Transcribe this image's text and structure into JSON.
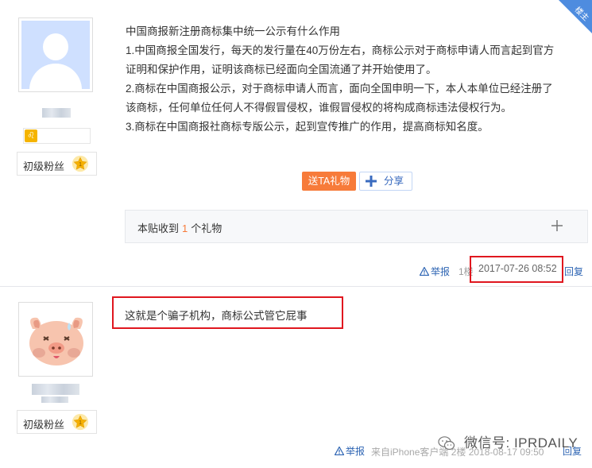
{
  "post1": {
    "badge": "楼主",
    "rank_label": "初级粉丝",
    "zodiac_symbol": "♌",
    "lines": [
      "中国商报新注册商标集中统一公示有什么作用",
      "1.中国商报全国发行，每天的发行量在40万份左右，商标公示对于商标申请人而言起到官方",
      "证明和保护作用，证明该商标已经面向全国流通了并开始使用了。",
      "2.商标在中国商报公示，对于商标申请人而言，面向全国申明一下，本人本单位已经注册了",
      "该商标，任何单位任何人不得假冒侵权，谁假冒侵权的将构成商标违法侵权行为。",
      "3.商标在中国商报社商标专版公示，起到宣传推广的作用，提高商标知名度。"
    ],
    "gift_button": "送TA礼物",
    "share_button": "分享",
    "gift_box": {
      "prefix": "本贴收到",
      "count": "1",
      "suffix": "个礼物"
    },
    "report": "举报",
    "floor": "1楼",
    "date": "2017-07-26 08:52",
    "reply": "回复"
  },
  "post2": {
    "rank_label": "初级粉丝",
    "text": "这就是个骗子机构，商标公式管它屁事",
    "report": "举报",
    "meta": "来自iPhone客户端  2楼  2018-08-17 09:50",
    "reply": "回复"
  },
  "watermark": {
    "text": "微信号: IPRDAILY"
  },
  "colors": {
    "accent_orange": "#f77b3a",
    "link_blue": "#2d64b3",
    "highlight_red": "#e0171f",
    "badge_blue": "#4e8cdf"
  }
}
